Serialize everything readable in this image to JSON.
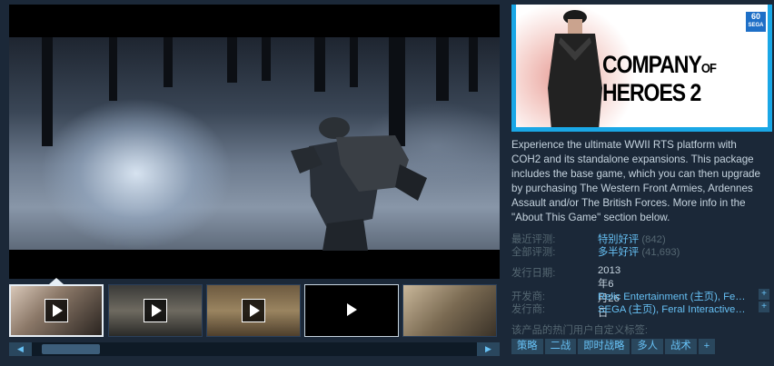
{
  "media": {
    "thumbnails": [
      {
        "name": "video-1",
        "type": "video",
        "selected": true
      },
      {
        "name": "video-2",
        "type": "video",
        "selected": false
      },
      {
        "name": "video-3",
        "type": "video",
        "selected": false
      },
      {
        "name": "video-4",
        "type": "video",
        "selected": false
      },
      {
        "name": "screenshot-1",
        "type": "image",
        "selected": false
      }
    ],
    "scroll_left_icon": "left-arrow-icon",
    "scroll_right_icon": "right-arrow-icon"
  },
  "game": {
    "capsule_title": "COMPANY OF HEROES 2",
    "capsule_title_main": "COMPANY",
    "capsule_title_of": "OF",
    "capsule_title_end": "HEROES 2",
    "publisher_badge": "60",
    "publisher_badge_sub": "SEGA",
    "description": "Experience the ultimate WWII RTS platform with COH2 and its standalone expansions. This package includes the base game, which you can then upgrade by purchasing The Western Front Armies, Ardennes Assault and/or The British Forces. More info in the \"About This Game\" section below."
  },
  "reviews": {
    "recent_label": "最近评测:",
    "recent_value": "特别好评",
    "recent_count": "(842)",
    "all_label": "全部评测:",
    "all_value": "多半好评",
    "all_count": "(41,693)"
  },
  "release": {
    "label": "发行日期:",
    "value": "2013年6月26日"
  },
  "developer": {
    "label": "开发商:",
    "value": "Relic Entertainment (主页), Fe…",
    "more": "+"
  },
  "publisher": {
    "label": "发行商:",
    "value": "SEGA (主页), Feral Interactive…",
    "more": "+"
  },
  "tags": {
    "header": "该产品的热门用户自定义标签:",
    "items": [
      "策略",
      "二战",
      "即时战略",
      "多人",
      "战术"
    ],
    "more": "+"
  },
  "colors": {
    "background": "#1b2838",
    "accent": "#66c0f4",
    "label": "#556772",
    "tag_bg": "#2a475e"
  }
}
